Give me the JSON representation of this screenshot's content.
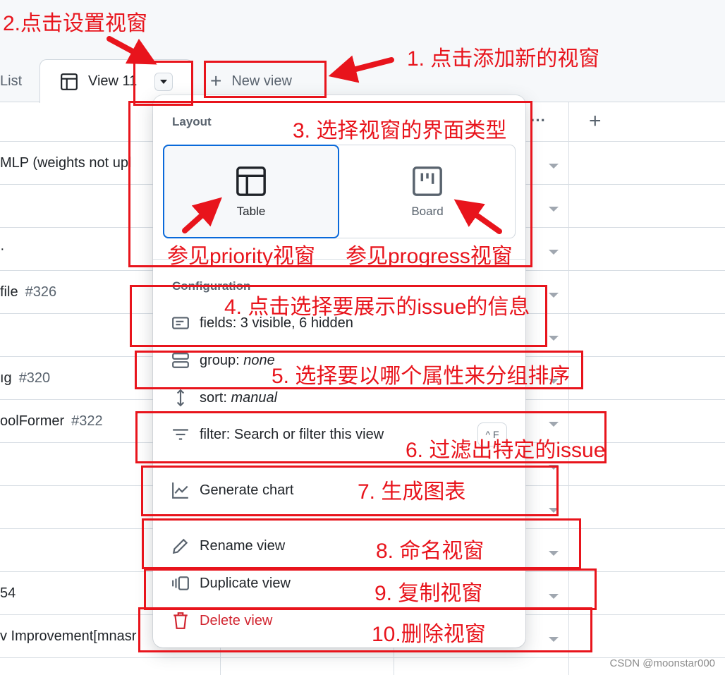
{
  "tabs": [
    {
      "label": "List"
    },
    {
      "label": "View 11",
      "active": true
    }
  ],
  "new_view_label": "New view",
  "header": {
    "more": "···",
    "add": "+"
  },
  "rows": [
    {
      "title": "MLP (weights not upl",
      "number": ""
    },
    {
      "title": "",
      "number": ""
    },
    {
      "title": "·",
      "number": ""
    },
    {
      "title": "file",
      "number": "#326"
    },
    {
      "title": "",
      "number": ""
    },
    {
      "title": "ıg",
      "number": "#320"
    },
    {
      "title": "oolFormer",
      "number": "#322"
    },
    {
      "title": "",
      "number": ""
    },
    {
      "title": "",
      "number": ""
    },
    {
      "title": "",
      "number": ""
    },
    {
      "title": "54",
      "number": ""
    },
    {
      "title": "v Improvement[mnasr",
      "number": ""
    }
  ],
  "menu": {
    "layout_label": "Layout",
    "layouts": [
      {
        "label": "Table",
        "selected": true,
        "icon": "table-icon"
      },
      {
        "label": "Board",
        "selected": false,
        "icon": "board-icon"
      }
    ],
    "configuration_label": "Configuration",
    "fields": "fields: 3 visible, 6 hidden",
    "group_prefix": "group: ",
    "group_value": "none",
    "sort_prefix": "sort: ",
    "sort_value": "manual",
    "filter": "filter: Search or filter this view",
    "filter_shortcut": "^ F",
    "generate_chart": "Generate chart",
    "rename": "Rename view",
    "duplicate": "Duplicate view",
    "delete": "Delete view"
  },
  "annotations": {
    "a1": "1. 点击添加新的视窗",
    "a2": "2.点击设置视窗",
    "a3": "3. 选择视窗的界面类型",
    "a3b": "参见priority视窗",
    "a3c": "参见progress视窗",
    "a4": "4. 点击选择要展示的issue的信息",
    "a5": "5. 选择要以哪个属性来分组排序",
    "a6": "6. 过滤出特定的issue",
    "a7": "7. 生成图表",
    "a8": "8. 命名视窗",
    "a9": "9. 复制视窗",
    "a10": "10.删除视窗"
  },
  "watermark": "CSDN @moonstar000",
  "colors": {
    "annotation": "#e8141c",
    "selected_border": "#0969da",
    "danger": "#d1242f"
  }
}
